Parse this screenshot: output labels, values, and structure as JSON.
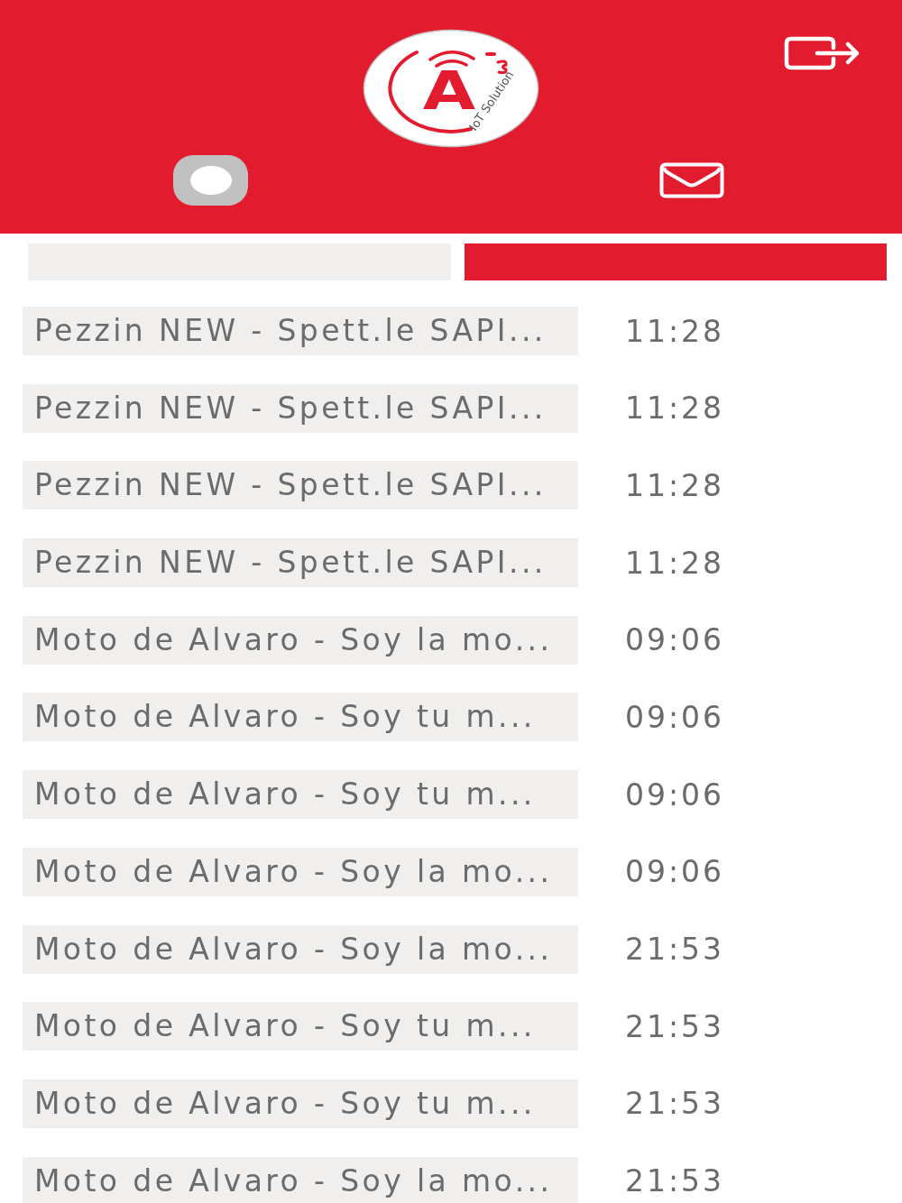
{
  "header": {
    "logo": {
      "letter": "A",
      "tagline": "IoT Solution"
    },
    "toggle": {
      "on": false
    }
  },
  "tabs": [
    {
      "selected": false
    },
    {
      "selected": true
    }
  ],
  "messages": [
    {
      "title": "Pezzin NEW - Spett.le SAPI...",
      "time": "11:28"
    },
    {
      "title": "Pezzin NEW - Spett.le SAPI...",
      "time": "11:28"
    },
    {
      "title": "Pezzin NEW - Spett.le SAPI...",
      "time": "11:28"
    },
    {
      "title": "Pezzin NEW - Spett.le SAPI...",
      "time": "11:28"
    },
    {
      "title": "Moto de Alvaro - Soy la mo...",
      "time": "09:06"
    },
    {
      "title": "Moto de Alvaro - Soy tu m...",
      "time": "09:06"
    },
    {
      "title": "Moto de Alvaro - Soy tu m...",
      "time": "09:06"
    },
    {
      "title": "Moto de Alvaro - Soy la mo...",
      "time": "09:06"
    },
    {
      "title": "Moto de Alvaro - Soy la mo...",
      "time": "21:53"
    },
    {
      "title": "Moto de Alvaro - Soy tu m...",
      "time": "21:53"
    },
    {
      "title": "Moto de Alvaro - Soy tu m...",
      "time": "21:53"
    },
    {
      "title": "Moto de Alvaro - Soy la mo...",
      "time": "21:53"
    }
  ]
}
